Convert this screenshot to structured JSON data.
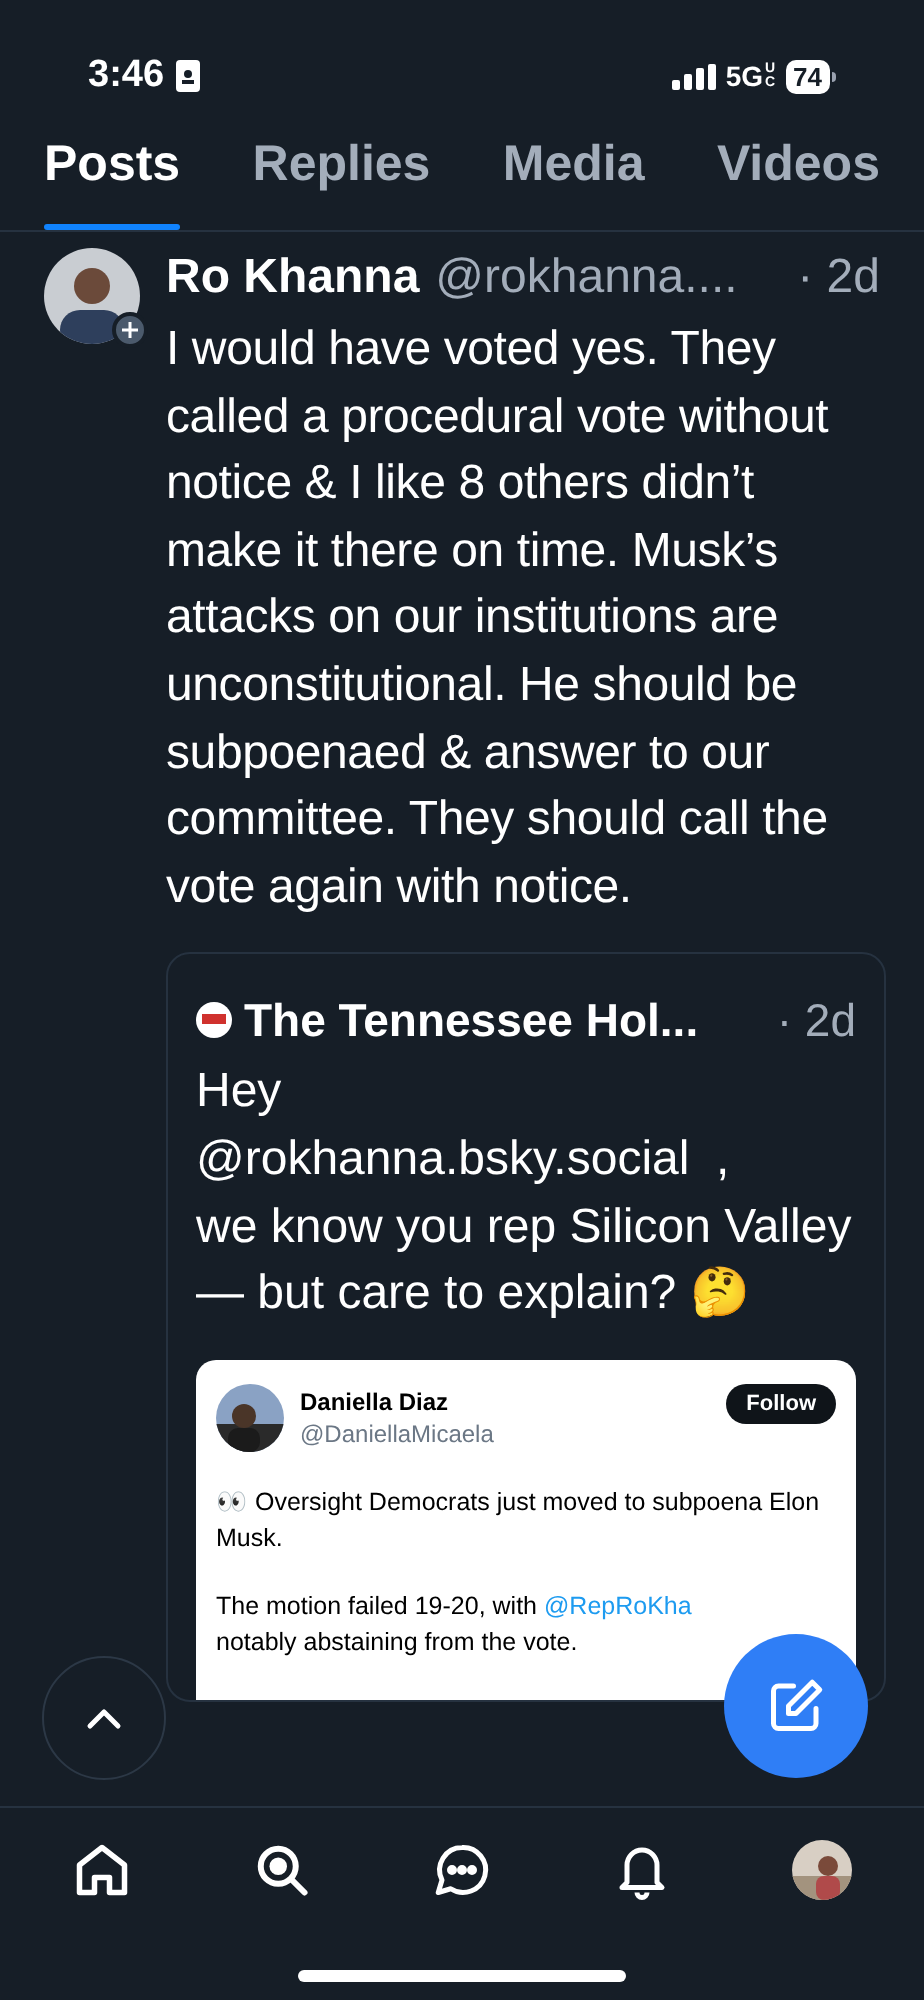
{
  "status_bar": {
    "time": "3:46",
    "network": "5G",
    "network_sub": "UC",
    "battery": "74"
  },
  "tabs": [
    {
      "label": "Posts",
      "selected": true
    },
    {
      "label": "Replies",
      "selected": false
    },
    {
      "label": "Media",
      "selected": false
    },
    {
      "label": "Videos",
      "selected": false
    }
  ],
  "post": {
    "author": "Ro Khanna",
    "handle": "@rokhanna....",
    "time": "· 2d",
    "text": "I would have voted yes. They called a procedural vote without notice & I like 8 others didn’t make it there on time. Musk’s attacks on our institutions are unconstitutional. He should be subpoenaed & answer to our committee. They should call the vote again with notice.",
    "quote": {
      "author": "The Tennessee Hol...",
      "time": "· 2d",
      "text_lines": [
        "Hey",
        "@rokhanna.bsky.social  ,",
        "we know you rep Silicon Valley — but care to explain? 🤔"
      ],
      "embed": {
        "name": "Daniella Diaz",
        "handle": "@DaniellaMicaela",
        "follow": "Follow",
        "paragraph_1": "👀 Oversight Democrats just moved to subpoena Elon Musk.",
        "paragraph_2_start": "The motion failed 19-20, with ",
        "paragraph_2_link": "@RepRoKha",
        "paragraph_2_end": "notably abstaining from the vote."
      }
    }
  },
  "nav": [
    {
      "kind": "home"
    },
    {
      "kind": "search"
    },
    {
      "kind": "chat"
    },
    {
      "kind": "bell"
    },
    {
      "kind": "avatar"
    }
  ]
}
